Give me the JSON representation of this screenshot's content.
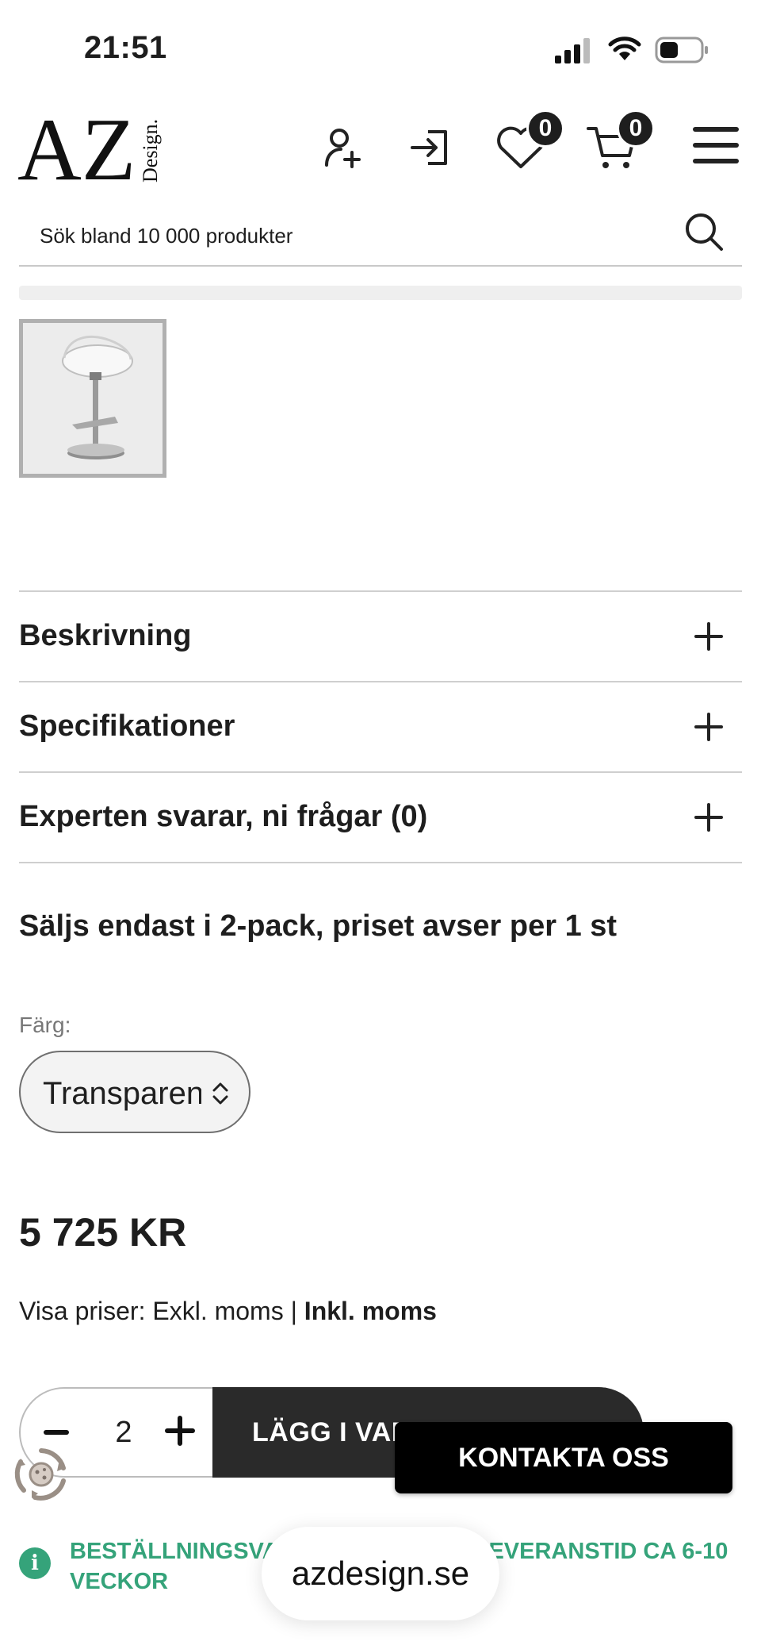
{
  "status_bar": {
    "time": "21:51"
  },
  "header": {
    "logo_main": "AZ",
    "logo_sub": "Design.",
    "wishlist_count": "0",
    "cart_count": "0"
  },
  "search": {
    "placeholder": "Sök bland 10 000 produkter"
  },
  "accordion": [
    {
      "label": "Beskrivning"
    },
    {
      "label": "Specifikationer"
    },
    {
      "label": "Experten svarar, ni frågar (0)"
    }
  ],
  "product": {
    "pack_note": "Säljs endast i 2-pack, priset avser per 1 st",
    "color_label": "Färg:",
    "color_value": "Transparent",
    "price": "5 725 KR",
    "vat_prefix": "Visa priser: Exkl. moms | ",
    "vat_active": "Inkl. moms",
    "quantity": "2",
    "add_to_cart": "LÄGG I VARUKORGEN"
  },
  "contact_button": "KONTAKTA OSS",
  "delivery_notice": "BESTÄLLNINGSVARA – BERÄKNAD LEVERANSTID CA 6-10 VECKOR",
  "browser": {
    "url": "azdesign.se"
  },
  "colors": {
    "accent_green": "#35a37a",
    "dark": "#2a2a2a"
  }
}
